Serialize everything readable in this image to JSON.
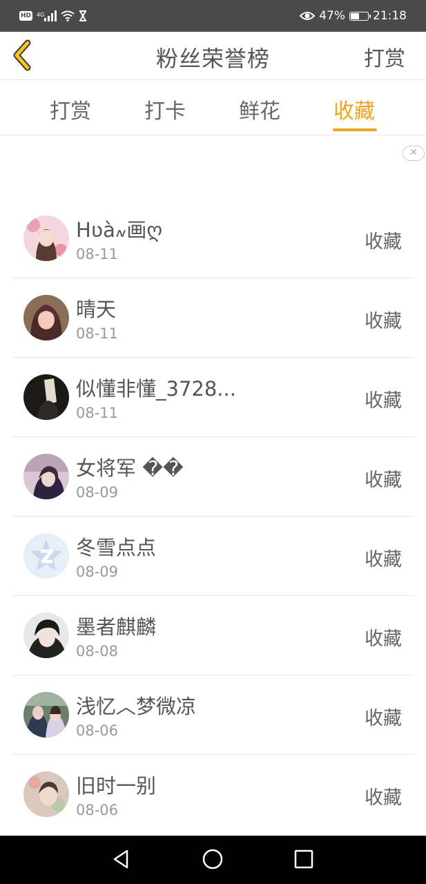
{
  "status_bar": {
    "network": "4G",
    "battery": "47%",
    "battery_level": 0.47,
    "time": "21:18"
  },
  "header": {
    "title": "粉丝荣誉榜",
    "action": "打赏",
    "back_icon": "chevron-left-icon",
    "accent_color": "#f5a21b"
  },
  "tabs": [
    {
      "label": "打赏",
      "active": false
    },
    {
      "label": "打卡",
      "active": false
    },
    {
      "label": "鲜花",
      "active": false
    },
    {
      "label": "收藏",
      "active": true
    }
  ],
  "list": [
    {
      "name": "Hʋà៷画ღ",
      "date": "08-11",
      "action": "收藏"
    },
    {
      "name": "晴天",
      "date": "08-11",
      "action": "收藏"
    },
    {
      "name": "似懂非懂_3728...",
      "date": "08-11",
      "action": "收藏"
    },
    {
      "name": "女将军 ��",
      "date": "08-09",
      "action": "收藏"
    },
    {
      "name": "冬雪点点",
      "date": "08-09",
      "action": "收藏"
    },
    {
      "name": "墨者麒麟",
      "date": "08-08",
      "action": "收藏"
    },
    {
      "name": "浅忆︿梦微凉",
      "date": "08-06",
      "action": "收藏"
    },
    {
      "name": "旧时一别",
      "date": "08-06",
      "action": "收藏"
    }
  ]
}
